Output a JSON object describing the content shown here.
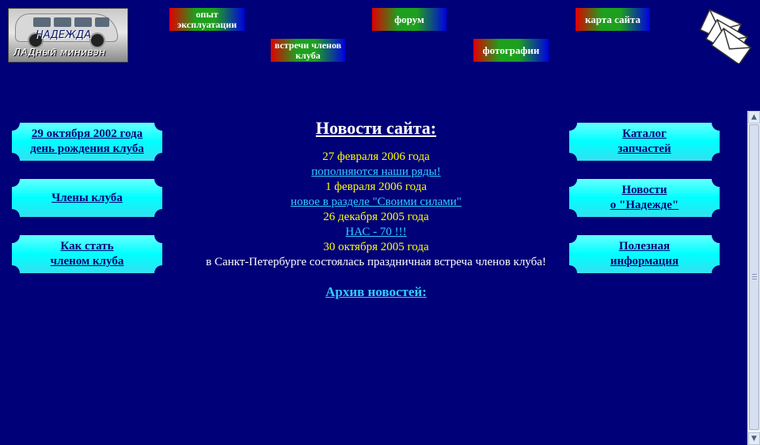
{
  "logo": {
    "line1": "НАДЕЖДА",
    "line2": "ЛАДный минивэн"
  },
  "top_nav": {
    "experience": "опыт эксплуатации",
    "meetings": "встречи членов клуба",
    "forum": "форум",
    "photos": "фотографии",
    "sitemap": "карта сайта"
  },
  "left_menu": [
    {
      "line1": "29 октября 2002 года",
      "line2": "день рождения клуба"
    },
    {
      "line1": "Члены клуба",
      "line2": ""
    },
    {
      "line1": "Как стать",
      "line2": "членом клуба"
    }
  ],
  "right_menu": [
    {
      "line1": "Каталог",
      "line2": "запчастей"
    },
    {
      "line1": "Новости",
      "line2": "о \"Надежде\""
    },
    {
      "line1": "Полезная",
      "line2": "информация"
    }
  ],
  "news": {
    "title": "Новости сайта:",
    "items": [
      {
        "date": "27 февраля 2006 года",
        "text": "пополняются наши ряды!"
      },
      {
        "date": "1 февраля 2006 года",
        "text": "новое в разделе \"Своими силами\""
      },
      {
        "date": "26 декабря 2005 года",
        "text": "НАС - 70 !!!"
      },
      {
        "date": "30 октября 2005 года",
        "text": "в Санкт-Петербурге состоялась праздничная встреча членов клуба!"
      }
    ],
    "archive": "Архив новостей:"
  },
  "colors": {
    "background": "#000078",
    "button_cyan": "#00ffff",
    "date_yellow": "#ffff00",
    "link_cyan": "#33ccff"
  }
}
